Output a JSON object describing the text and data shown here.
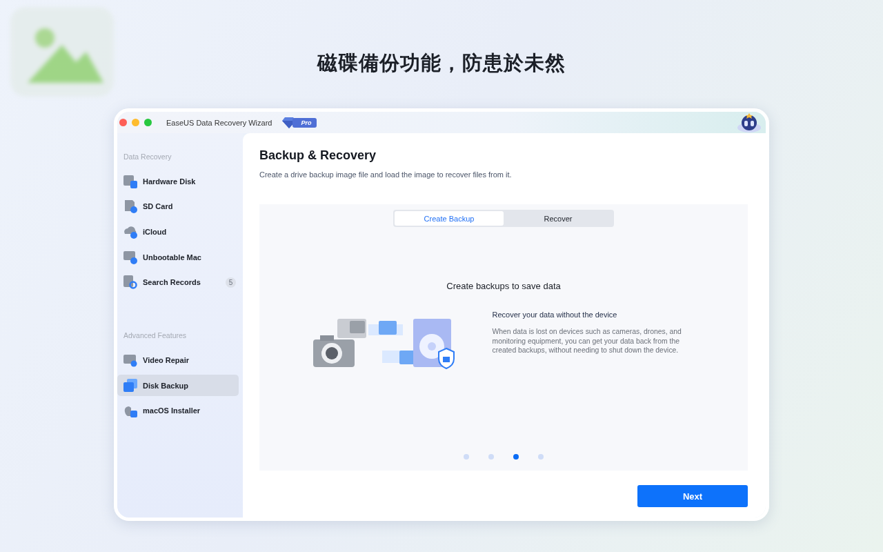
{
  "headline": "磁碟備份功能，防患於未然",
  "window": {
    "title": "EaseUS Data Recovery Wizard",
    "edition": "Pro"
  },
  "sidebar": {
    "sections": [
      {
        "title": "Data Recovery",
        "items": [
          {
            "kind": "disk",
            "label": "Hardware Disk",
            "selected": false
          },
          {
            "kind": "sd",
            "label": "SD Card",
            "selected": false
          },
          {
            "kind": "cloud",
            "label": "iCloud",
            "selected": false
          },
          {
            "kind": "mac",
            "label": "Unbootable Mac",
            "selected": false
          },
          {
            "kind": "search",
            "label": "Search Records",
            "selected": false,
            "badge": "5"
          }
        ]
      },
      {
        "title": "Advanced Features",
        "items": [
          {
            "kind": "video",
            "label": "Video Repair",
            "selected": false
          },
          {
            "kind": "backup",
            "label": "Disk Backup",
            "selected": true
          },
          {
            "kind": "installer",
            "label": "macOS Installer",
            "selected": false
          }
        ]
      }
    ]
  },
  "main": {
    "title": "Backup & Recovery",
    "subtitle": "Create a drive backup image file and load the image to recover files from it.",
    "tabs": [
      {
        "label": "Create Backup",
        "selected": true
      },
      {
        "label": "Recover",
        "selected": false
      }
    ],
    "slide": {
      "heading": "Create backups to save data",
      "title": "Recover your data without the device",
      "body": "When data is lost on devices such as cameras, drones, and monitoring equipment, you can get your data back from the created backups, without needing to shut down the device."
    },
    "dots": [
      {
        "selected": false
      },
      {
        "selected": false
      },
      {
        "selected": true
      },
      {
        "selected": false
      }
    ],
    "next_button": "Next"
  }
}
